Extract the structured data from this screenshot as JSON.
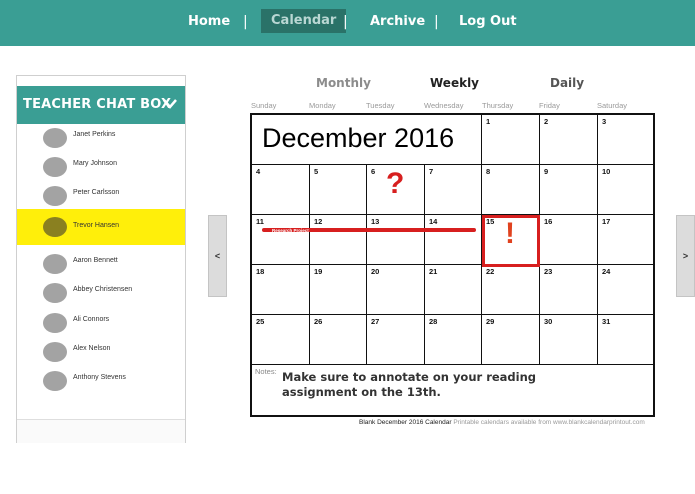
{
  "nav": {
    "items": [
      "Home",
      "Calendar",
      "Archive",
      "Log Out"
    ],
    "separator": "|",
    "active": "Calendar"
  },
  "chat": {
    "title": "TEACHER CHAT BOX",
    "contacts": [
      "Janet Perkins",
      "Mary Johnson",
      "Peter Carlsson",
      "Trevor Hansen",
      "Aaron Bennett",
      "Abbey Christensen",
      "Ali Connors",
      "Alex Nelson",
      "Anthony Stevens"
    ],
    "selected": "Trevor Hansen"
  },
  "views": [
    "Monthly",
    "Weekly",
    "Daily"
  ],
  "weekdays": [
    "Sunday",
    "Monday",
    "Tuesday",
    "Wednesday",
    "Thursday",
    "Friday",
    "Saturday"
  ],
  "calendar": {
    "title": "December 2016",
    "days": [
      "1",
      "2",
      "3",
      "4",
      "5",
      "6",
      "7",
      "8",
      "9",
      "10",
      "11",
      "12",
      "13",
      "14",
      "15",
      "16",
      "17",
      "18",
      "19",
      "20",
      "21",
      "22",
      "23",
      "24",
      "25",
      "26",
      "27",
      "28",
      "29",
      "30",
      "31"
    ],
    "notes_label": "Notes:",
    "notes_text": "Make sure to annotate on your reading assignment on the 13th.",
    "event_label": "Research Project",
    "question_mark": "?",
    "exclamation": "!"
  },
  "caption": {
    "title": "Blank December 2016 Calendar",
    "source": "Printable calendars available from www.blankcalendarprintout.com"
  },
  "arrows": {
    "prev": "<",
    "next": ">"
  },
  "colors": {
    "accent": "#3a9e94",
    "accent_dark": "#2a7268",
    "highlight": "#ffef0a",
    "annotation_red": "#d71f1f"
  }
}
